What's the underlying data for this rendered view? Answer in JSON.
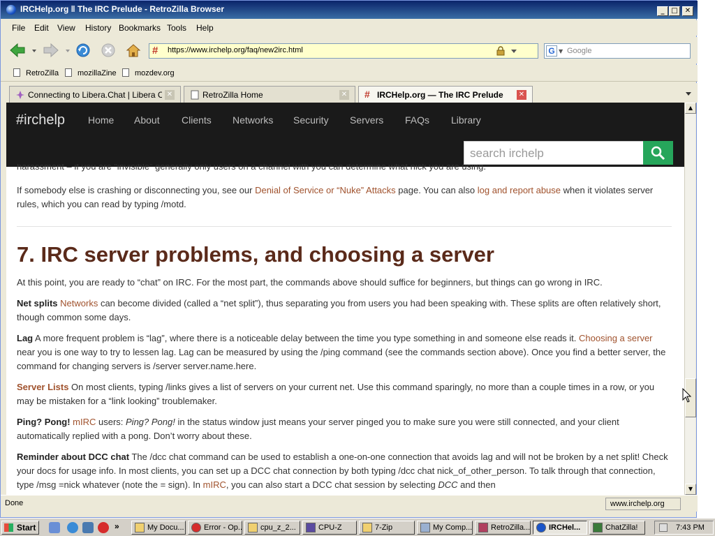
{
  "window": {
    "title": "IRCHelp.org ‖ The IRC Prelude - RetroZilla Browser",
    "min": "_",
    "max": "□",
    "close": "✕"
  },
  "menu": [
    "File",
    "Edit",
    "View",
    "History",
    "Bookmarks",
    "Tools",
    "Help"
  ],
  "nav": {
    "url": "https://www.irchelp.org/faq/new2irc.html",
    "url_prefix": "#",
    "search_placeholder": "Google",
    "search_engine": "G"
  },
  "bookmarks": [
    "RetroZilla",
    "mozillaZine",
    "mozdev.org"
  ],
  "tabs": [
    {
      "label": "Connecting to Libera.Chat | Libera Chat",
      "active": false
    },
    {
      "label": "RetroZilla Home",
      "active": false
    },
    {
      "label": "IRCHelp.org — The IRC Prelude",
      "active": true
    }
  ],
  "tab_close": "✕",
  "site": {
    "brand": "#irchelp",
    "nav": [
      "Home",
      "About",
      "Clients",
      "Networks",
      "Security",
      "Servers",
      "FAQs",
      "Library"
    ],
    "search_placeholder": "search irchelp"
  },
  "article": {
    "p_top_cut": "harassment – if you are “invisible” generally only users on a channel with you can determine what nick you are using.",
    "p_dos_1": "If somebody else is crashing or disconnecting you, see our ",
    "p_dos_link1": "Denial of Service or “Nuke” Attacks",
    "p_dos_2": " page. You can also ",
    "p_dos_link2": "log and report abuse",
    "p_dos_3": " when it violates server rules, which you can read by typing /motd.",
    "heading": "7. IRC server problems, and choosing a server",
    "p_intro": "At this point, you are ready to “chat” on IRC. For the most part, the commands above should suffice for beginners, but things can go wrong in IRC.",
    "netsplits_label": "Net splits",
    "netsplits_link": "Networks",
    "netsplits_text": " can become divided (called a “net split”), thus separating you from users you had been speaking with. These splits are often relatively short, though common some days.",
    "lag_label": "Lag",
    "lag_text1": " A more frequent problem is “lag”, where there is a noticeable delay between the time you type something in and someone else reads it. ",
    "lag_link": "Choosing a server",
    "lag_text2": " near you is one way to try to lessen lag. Lag can be measured by using the /ping command (see the commands section above). Once you find a better server, the command for changing servers is /server server.name.here.",
    "servers_label": "Server Lists",
    "servers_text": " On most clients, typing /links gives a list of servers on your current net. Use this command sparingly, no more than a couple times in a row, or you may be mistaken for a “link looking” troublemaker.",
    "ping_label": "Ping? Pong!",
    "ping_link": "mIRC",
    "ping_text1": " users: ",
    "ping_italic": "Ping? Pong!",
    "ping_text2": " in the status window just means your server pinged you to make sure you were still connected, and your client automatically replied with a pong. Don’t worry about these.",
    "dcc_label": "Reminder about DCC chat",
    "dcc_text1": " The /dcc chat command can be used to establish a one-on-one connection that avoids lag and will not be broken by a net split! Check your docs for usage info. In most clients, you can set up a DCC chat connection by both typing /dcc chat nick_of_other_person. To talk through that connection, type /msg =nick whatever (note the = sign). In ",
    "dcc_link": "mIRC",
    "dcc_text2": ", you can also start a DCC chat session by selecting ",
    "dcc_italic": "DCC",
    "dcc_text3": " and then"
  },
  "status": {
    "text": "Done",
    "host": "www.irchelp.org"
  },
  "taskbar": {
    "start": "Start",
    "tasks": [
      {
        "label": "My Docu...",
        "active": false
      },
      {
        "label": "Error - Op...",
        "active": false
      },
      {
        "label": "cpu_z_2...",
        "active": false
      },
      {
        "label": "CPU-Z",
        "active": false
      },
      {
        "label": "7-Zip",
        "active": false
      },
      {
        "label": "My Comp...",
        "active": false
      },
      {
        "label": "RetroZilla...",
        "active": false
      },
      {
        "label": "IRCHel...",
        "active": true
      },
      {
        "label": "ChatZilla!",
        "active": false
      }
    ],
    "chevron": "»",
    "clock": "7:43 PM"
  }
}
